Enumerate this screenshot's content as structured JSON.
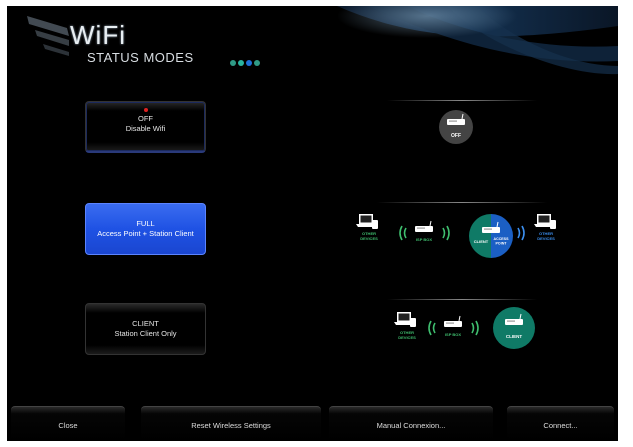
{
  "header": {
    "title": "WiFi",
    "subtitle": "STATUS MODES",
    "dot_colors": [
      "#2f9a86",
      "#2ab4a0",
      "#1e6fd8",
      "#2f9a86"
    ]
  },
  "modes": [
    {
      "line1": "OFF",
      "line2": "Disable Wifi",
      "selected": false,
      "led": true
    },
    {
      "line1": "FULL",
      "line2": "Access Point + Station Client",
      "selected": true,
      "led": false
    },
    {
      "line1": "CLIENT",
      "line2": "Station Client Only",
      "selected": false,
      "led": false
    }
  ],
  "diagrams": {
    "off": {
      "badge": "OFF"
    },
    "full": {
      "left_devices": "OTHER DEVICES",
      "isp": "ISP BOX",
      "client": "CLIENT",
      "access_point": "ACCESS POINT",
      "right_devices": "OTHER DEVICES"
    },
    "client": {
      "devices": "OTHER DEVICES",
      "isp": "ISP BOX",
      "client": "CLIENT"
    }
  },
  "colors": {
    "teal": "#0f7a66",
    "blue": "#1b5fc4",
    "accent_green": "#3fbf6f",
    "accent_blue": "#3b8ff0"
  },
  "bottom_bar": {
    "close": "Close",
    "reset": "Reset Wireless Settings",
    "manual": "Manual Connexion...",
    "connect": "Connect..."
  }
}
